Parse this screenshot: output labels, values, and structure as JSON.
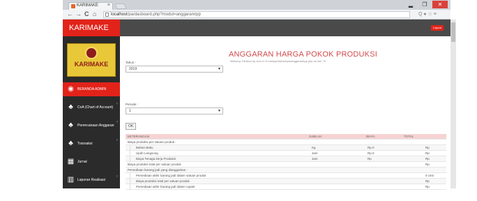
{
  "browser": {
    "tab_title": "KARIMAKE",
    "tab_close": "×",
    "window_min": "▂",
    "window_max": "❐",
    "window_close": "✕",
    "back": "←",
    "forward": "→",
    "reload": "C",
    "home": "⌂",
    "url_host": "localhost",
    "url_path": "/pa/dasboard.php?modul=anggarannpp",
    "extensions": "Q ● ☆ ≡"
  },
  "sidebar": {
    "brand": "KARIMAKE",
    "logo_text": "KARIMAKE",
    "items": [
      {
        "label": "BERANDA ADMIN",
        "icon": "dashboard-icon",
        "glyph": "◉"
      },
      {
        "label": "CoA (Chart of Account)",
        "icon": "sitemap-icon",
        "glyph": "♣"
      },
      {
        "label": "Perencanaan Anggaran",
        "icon": "sitemap-icon",
        "glyph": "♣"
      },
      {
        "label": "Transaksi",
        "icon": "sitemap-icon",
        "glyph": "♣"
      },
      {
        "label": "Jurnal",
        "icon": "grid-icon",
        "glyph": "▦"
      },
      {
        "label": "Laporan Realisasi Anggaran",
        "icon": "bar-chart-icon",
        "glyph": "▥"
      }
    ]
  },
  "topbar": {
    "logout": "Logout"
  },
  "main": {
    "title": "ANGGARAN HARGA POKOK PRODUKSI",
    "warning": "Warning: Division by zero in D:\\xampp\\htdocs\\pa\\anggaranhpp.php on line 70",
    "tahun_label": "Tahun :",
    "tahun_value": "2019",
    "periode_label": "Periode :",
    "periode_value": "1",
    "ok_button": "OK",
    "table": {
      "headers": [
        "KETERANGAN",
        "JUMLAH",
        "BIAYA",
        "TOTAL"
      ],
      "rows": [
        {
          "k": "Biaya produksi per satuan produk :",
          "j": "",
          "b": "",
          "t": "",
          "indent": 0
        },
        {
          "k": "Bahan Baku",
          "j": "Kg",
          "b": "Rp.0",
          "t": "Rp",
          "indent": 1
        },
        {
          "k": "Upah Langsung",
          "j": "Jam",
          "b": "Rp.0",
          "t": "Rp",
          "indent": 1
        },
        {
          "k": "Biaya Tenaga kerja Produksi",
          "j": "Jam",
          "b": "Rp",
          "t": "Rp",
          "indent": 1
        },
        {
          "k": "Biaya produksi total per satuan produk",
          "j": "",
          "b": "",
          "t": "Rp",
          "indent": 0
        },
        {
          "k": "Persediaan barang jadi yang dianggarkan :",
          "j": "",
          "b": "",
          "t": "",
          "indent": 0
        },
        {
          "k": "Persediaan akhir barang jadi dalam satuan produk",
          "j": "",
          "b": "",
          "t": "0 Unit",
          "indent": 1
        },
        {
          "k": "Biaya produksi total per satuan produk",
          "j": "",
          "b": "",
          "t": "Rp",
          "indent": 1
        },
        {
          "k": "Persediaan akhir barang jadi dalam rupiah",
          "j": "",
          "b": "",
          "t": "Rp",
          "indent": 1
        }
      ]
    }
  },
  "colors": {
    "accent": "#e2231a",
    "sidebar": "#2b2b2b",
    "topbar": "#4a4a4a"
  }
}
